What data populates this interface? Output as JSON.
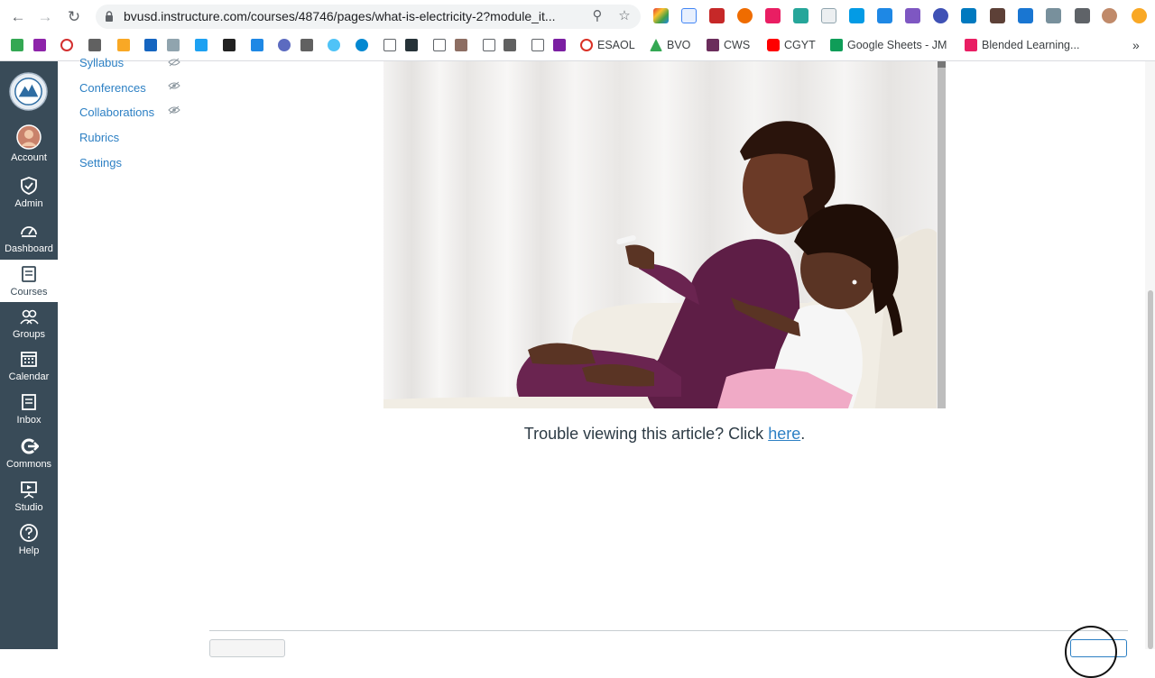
{
  "browser": {
    "url": "bvusd.instructure.com/courses/48746/pages/what-is-electricity-2?module_it...",
    "back_icon": "arrow-left-icon",
    "forward_icon": "arrow-right-icon",
    "reload_icon": "reload-icon",
    "bookmarks": [
      {
        "label": "ESAOL",
        "color": "#d93025"
      },
      {
        "label": "BVO",
        "color": "#34a853"
      },
      {
        "label": "CWS",
        "color": "#6b2d5c"
      },
      {
        "label": "CGYT",
        "color": "#ff0000"
      },
      {
        "label": "Google Sheets - JM",
        "color": "#0f9d58"
      },
      {
        "label": "Blended Learning...",
        "color": "#e91e63"
      }
    ],
    "more_bookmarks": "»"
  },
  "global_nav": {
    "items": [
      {
        "label": "Account",
        "icon": "avatar-icon"
      },
      {
        "label": "Admin",
        "icon": "shield-icon"
      },
      {
        "label": "Dashboard",
        "icon": "dashboard-icon"
      },
      {
        "label": "Courses",
        "icon": "book-icon"
      },
      {
        "label": "Groups",
        "icon": "groups-icon"
      },
      {
        "label": "Calendar",
        "icon": "calendar-icon"
      },
      {
        "label": "Inbox",
        "icon": "inbox-icon"
      },
      {
        "label": "Commons",
        "icon": "commons-icon"
      },
      {
        "label": "Studio",
        "icon": "studio-icon"
      },
      {
        "label": "Help",
        "icon": "help-icon"
      }
    ],
    "active": "Courses"
  },
  "course_nav": {
    "items": [
      {
        "label": "Syllabus",
        "hidden_icon": true
      },
      {
        "label": "Conferences",
        "hidden_icon": true
      },
      {
        "label": "Collaborations",
        "hidden_icon": true
      },
      {
        "label": "Rubrics",
        "hidden_icon": false
      },
      {
        "label": "Settings",
        "hidden_icon": false
      }
    ]
  },
  "content": {
    "caption_prefix": "Trouble viewing this article? Click ",
    "caption_link": "here",
    "caption_suffix": "."
  },
  "colors": {
    "nav_bg": "#394b58",
    "link": "#2d80c4",
    "text": "#2d3b45"
  }
}
